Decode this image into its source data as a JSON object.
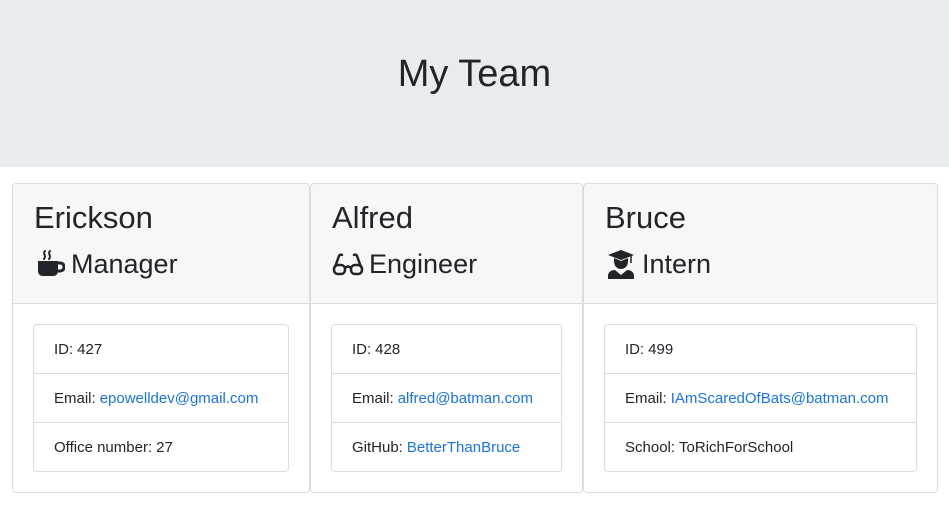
{
  "header": {
    "title": "My Team"
  },
  "members": [
    {
      "name": "Erickson",
      "role": "Manager",
      "role_icon": "coffee-mug-icon",
      "details": [
        {
          "label": "ID:",
          "value": "427"
        },
        {
          "label": "Email:",
          "value": "epowelldev@gmail.com"
        },
        {
          "label": "Office number:",
          "value": "27"
        }
      ]
    },
    {
      "name": "Alfred",
      "role": "Engineer",
      "role_icon": "glasses-icon",
      "details": [
        {
          "label": "ID:",
          "value": "428"
        },
        {
          "label": "Email:",
          "value": "alfred@batman.com"
        },
        {
          "label": "GitHub:",
          "value": "BetterThanBruce"
        }
      ]
    },
    {
      "name": "Bruce",
      "role": "Intern",
      "role_icon": "graduate-icon",
      "details": [
        {
          "label": "ID:",
          "value": "499"
        },
        {
          "label": "Email:",
          "value": "IAmScaredOfBats@batman.com"
        },
        {
          "label": "School:",
          "value": "ToRichForSchool"
        }
      ]
    }
  ],
  "colors": {
    "link": "#1a73e8",
    "header_bg": "#e9ecef",
    "card_header_bg": "#f7f7f7"
  }
}
